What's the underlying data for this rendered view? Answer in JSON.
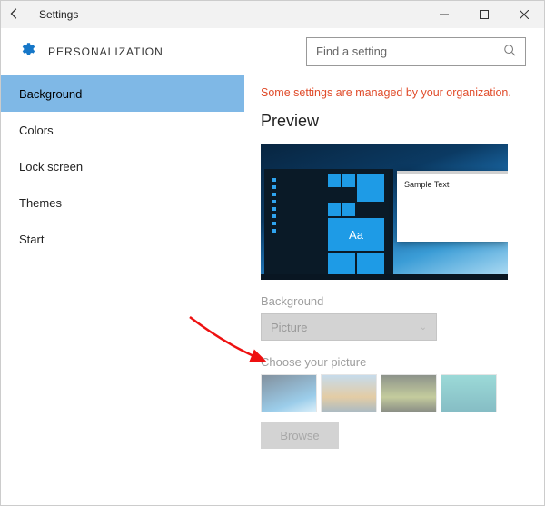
{
  "titlebar": {
    "app_name": "Settings"
  },
  "header": {
    "section": "PERSONALIZATION",
    "search_placeholder": "Find a setting"
  },
  "sidebar": {
    "items": [
      {
        "label": "Background",
        "selected": true
      },
      {
        "label": "Colors",
        "selected": false
      },
      {
        "label": "Lock screen",
        "selected": false
      },
      {
        "label": "Themes",
        "selected": false
      },
      {
        "label": "Start",
        "selected": false
      }
    ]
  },
  "content": {
    "org_warning": "Some settings are managed by your organization.",
    "preview_heading": "Preview",
    "sample_text": "Sample Text",
    "tile_glyph": "Aa",
    "background_label": "Background",
    "background_value": "Picture",
    "choose_label": "Choose your picture",
    "browse_label": "Browse"
  }
}
